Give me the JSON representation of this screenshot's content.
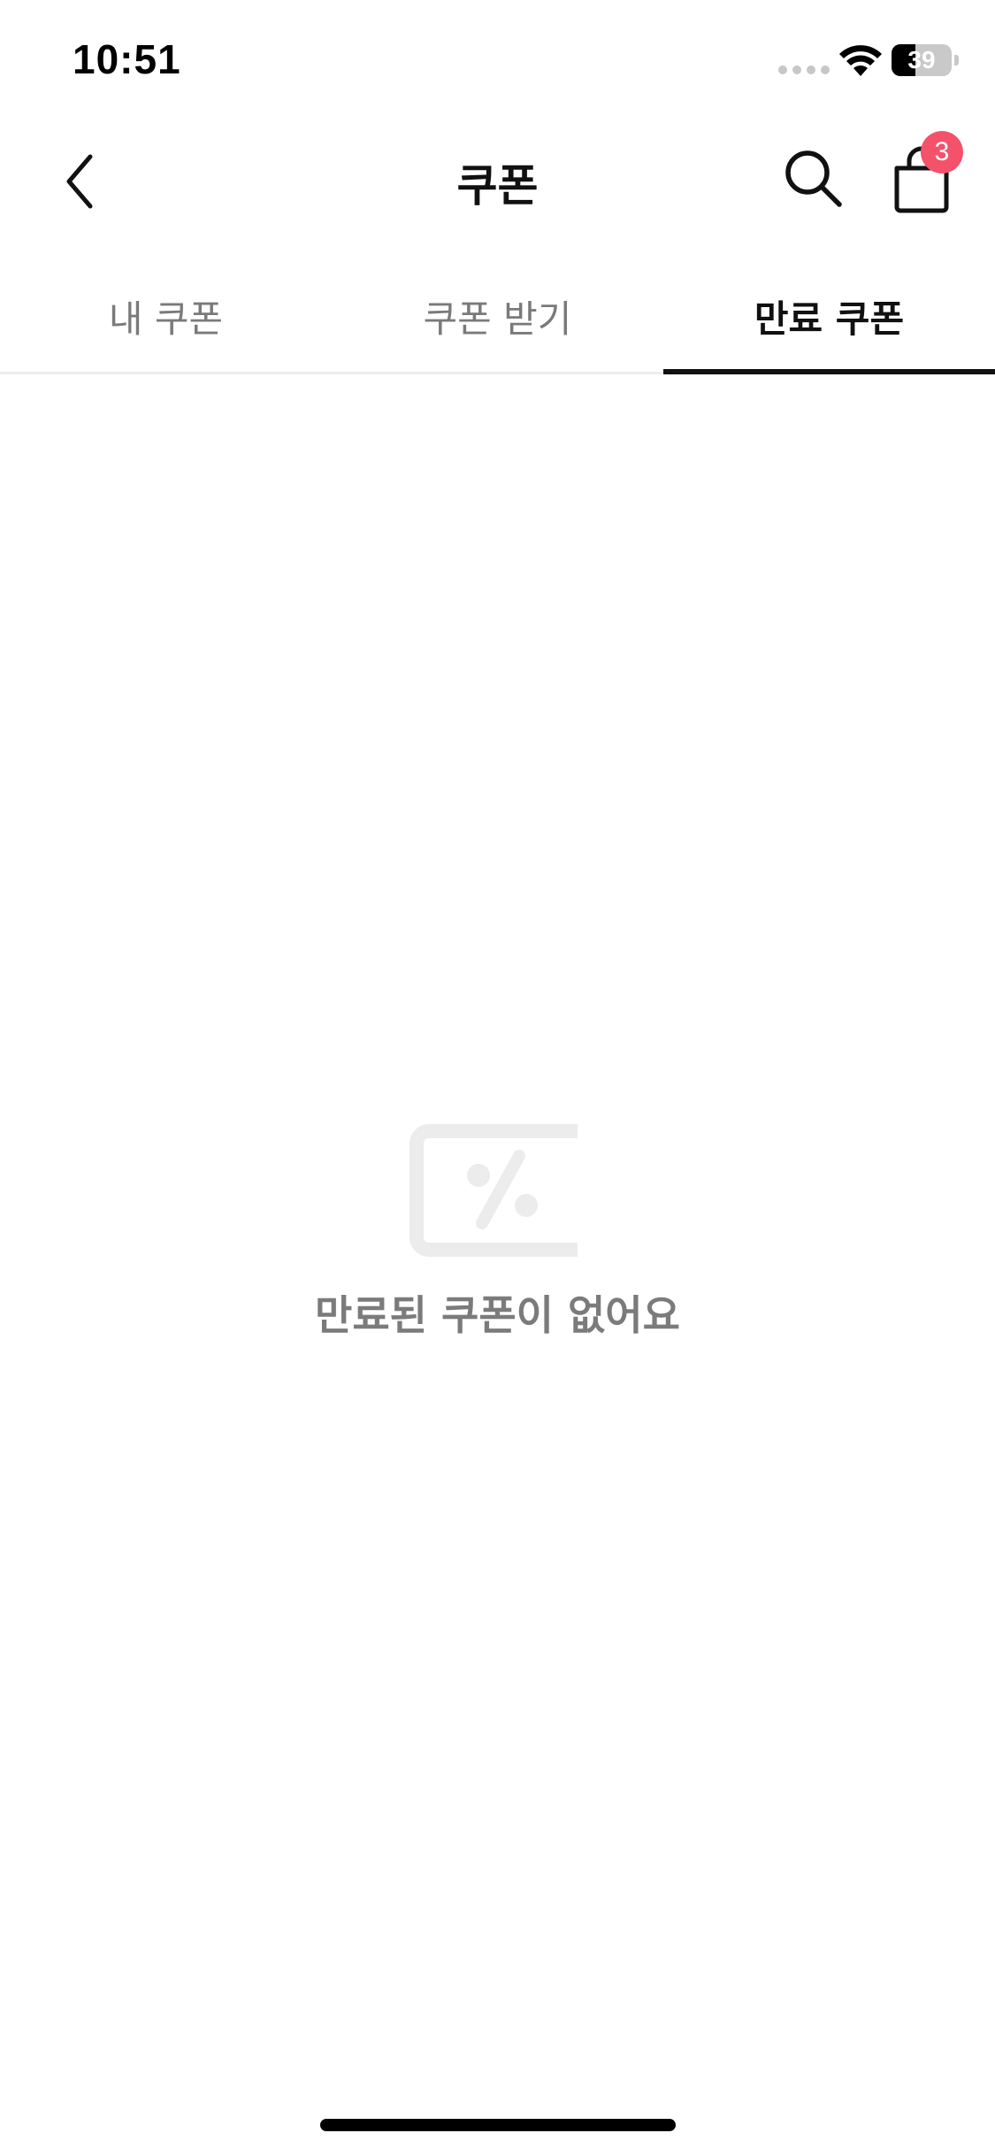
{
  "status_bar": {
    "time": "10:51",
    "battery_text": "39",
    "battery_level": 0.39
  },
  "nav": {
    "title": "쿠폰",
    "back_icon": "chevron-left-icon",
    "search_icon": "search-icon",
    "cart_icon": "shopping-bag-icon",
    "cart_badge": "3",
    "badge_color": "#f4516a"
  },
  "tabs": [
    {
      "label": "내 쿠폰",
      "active": false
    },
    {
      "label": "쿠폰 받기",
      "active": false
    },
    {
      "label": "만료 쿠폰",
      "active": true
    }
  ],
  "empty_state": {
    "icon": "coupon-percent-icon",
    "message": "만료된 쿠폰이 없어요"
  }
}
